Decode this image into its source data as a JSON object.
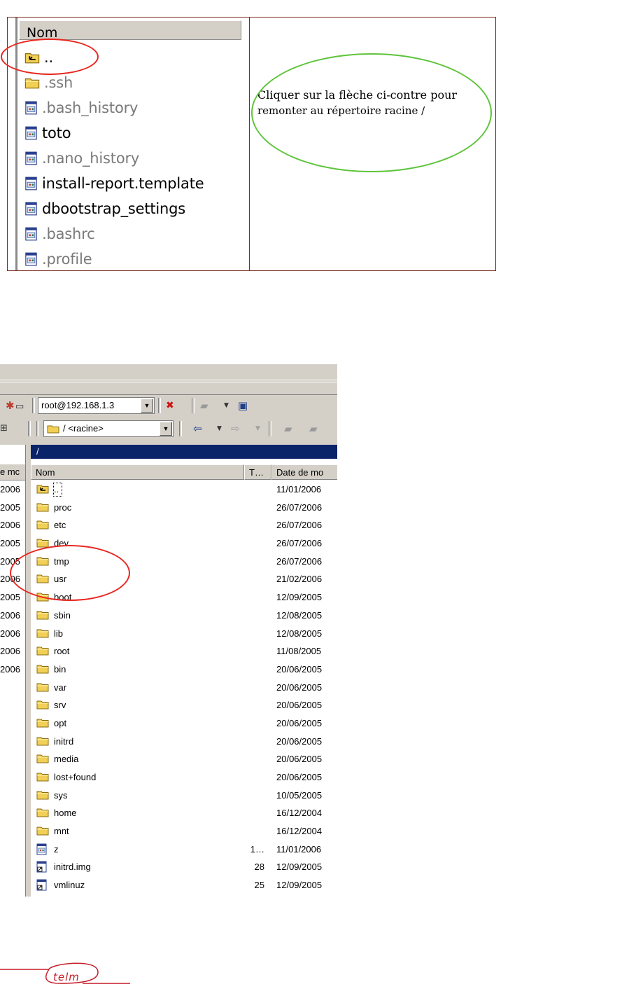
{
  "top_panel": {
    "column_header": "Nom",
    "files": [
      {
        "name": "..",
        "icon": "parent-folder-icon",
        "hidden": false
      },
      {
        "name": ".ssh",
        "icon": "folder-icon",
        "hidden": true
      },
      {
        "name": ".bash_history",
        "icon": "file-icon",
        "hidden": true
      },
      {
        "name": "toto",
        "icon": "file-icon",
        "hidden": false
      },
      {
        "name": ".nano_history",
        "icon": "file-icon",
        "hidden": true
      },
      {
        "name": "install-report.template",
        "icon": "file-icon",
        "hidden": false
      },
      {
        "name": "dbootstrap_settings",
        "icon": "file-icon",
        "hidden": false
      },
      {
        "name": ".bashrc",
        "icon": "file-icon",
        "hidden": true
      },
      {
        "name": ".profile",
        "icon": "file-icon",
        "hidden": true
      }
    ],
    "note_line1": "Cliquer sur la flèche ci-contre pour",
    "note_line2": "remonter au répertoire racine /"
  },
  "bottom_panel": {
    "session_combo": "root@192.168.1.3",
    "dir_combo": "/ <racine>",
    "current_path": "/",
    "left_header": "e mc",
    "left_dates": [
      "2006",
      "2005",
      "2006",
      "2005",
      "2005",
      "2006",
      "2005",
      "2006",
      "2006",
      "2006",
      "2006"
    ],
    "columns": {
      "name": "Nom",
      "type": "T…",
      "date": "Date de mo"
    },
    "rows": [
      {
        "name": "..",
        "icon": "parent-folder-icon",
        "size": "",
        "date": "11/01/2006"
      },
      {
        "name": "proc",
        "icon": "folder-icon",
        "size": "",
        "date": "26/07/2006"
      },
      {
        "name": "etc",
        "icon": "folder-icon",
        "size": "",
        "date": "26/07/2006"
      },
      {
        "name": "dev",
        "icon": "folder-icon",
        "size": "",
        "date": "26/07/2006"
      },
      {
        "name": "tmp",
        "icon": "folder-icon",
        "size": "",
        "date": "26/07/2006"
      },
      {
        "name": "usr",
        "icon": "folder-icon",
        "size": "",
        "date": "21/02/2006"
      },
      {
        "name": "boot",
        "icon": "folder-icon",
        "size": "",
        "date": "12/09/2005"
      },
      {
        "name": "sbin",
        "icon": "folder-icon",
        "size": "",
        "date": "12/08/2005"
      },
      {
        "name": "lib",
        "icon": "folder-icon",
        "size": "",
        "date": "12/08/2005"
      },
      {
        "name": "root",
        "icon": "folder-icon",
        "size": "",
        "date": "11/08/2005"
      },
      {
        "name": "bin",
        "icon": "folder-icon",
        "size": "",
        "date": "20/06/2005"
      },
      {
        "name": "var",
        "icon": "folder-icon",
        "size": "",
        "date": "20/06/2005"
      },
      {
        "name": "srv",
        "icon": "folder-icon",
        "size": "",
        "date": "20/06/2005"
      },
      {
        "name": "opt",
        "icon": "folder-icon",
        "size": "",
        "date": "20/06/2005"
      },
      {
        "name": "initrd",
        "icon": "folder-icon",
        "size": "",
        "date": "20/06/2005"
      },
      {
        "name": "media",
        "icon": "folder-icon",
        "size": "",
        "date": "20/06/2005"
      },
      {
        "name": "lost+found",
        "icon": "folder-icon",
        "size": "",
        "date": "20/06/2005"
      },
      {
        "name": "sys",
        "icon": "folder-icon",
        "size": "",
        "date": "10/05/2005"
      },
      {
        "name": "home",
        "icon": "folder-icon",
        "size": "",
        "date": "16/12/2004"
      },
      {
        "name": "mnt",
        "icon": "folder-icon",
        "size": "",
        "date": "16/12/2004"
      },
      {
        "name": "z",
        "icon": "file-icon",
        "size": "1…",
        "date": "11/01/2006"
      },
      {
        "name": "initrd.img",
        "icon": "link-file-icon",
        "size": "28",
        "date": "12/09/2005"
      },
      {
        "name": "vmlinuz",
        "icon": "link-file-icon",
        "size": "25",
        "date": "12/09/2005"
      }
    ]
  },
  "logo": {
    "text": "telm"
  },
  "colors": {
    "annotation_red": "#e8261f",
    "annotation_green": "#5fc43b",
    "selection_blue": "#0a246a",
    "folder_yellow": "#f2cf55",
    "frame_brown": "#7b2a1c"
  }
}
